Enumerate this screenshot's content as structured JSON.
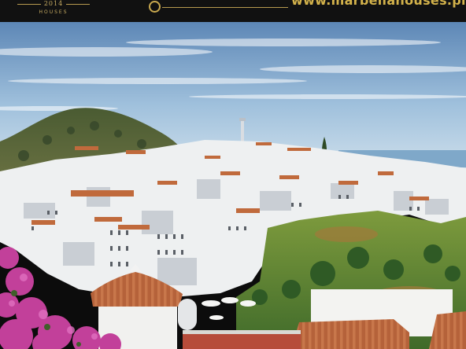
{
  "banner": {
    "logo_year": "2014",
    "logo_sub": "HOUSES",
    "url": "www.marbellahouses.pl",
    "colors": {
      "background": "#111111",
      "gold": "#c9ad63"
    }
  },
  "photo": {
    "subject": "whitewashed hillside village with terracotta roofs, hill, sea and bougainvillea"
  }
}
